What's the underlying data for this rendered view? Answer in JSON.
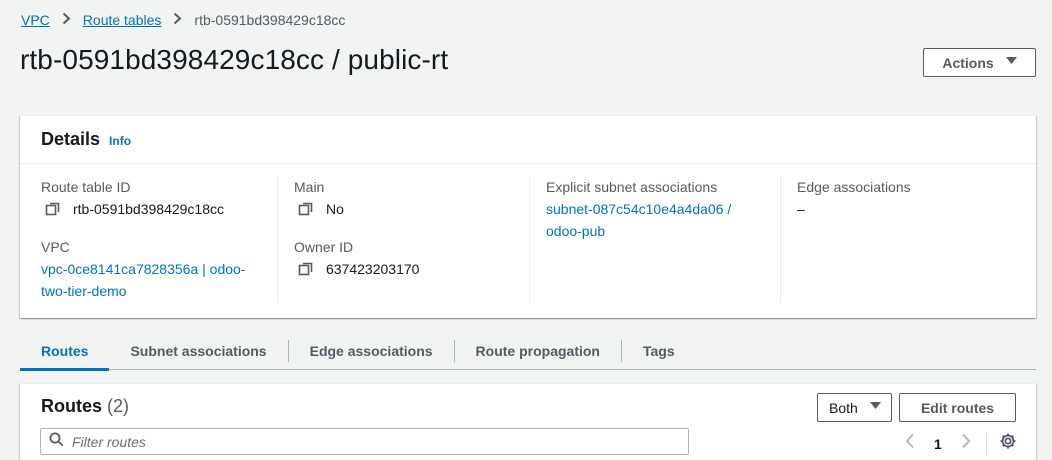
{
  "breadcrumb": {
    "items": [
      "VPC",
      "Route tables"
    ],
    "current": "rtb-0591bd398429c18cc"
  },
  "page_title": "rtb-0591bd398429c18cc / public-rt",
  "actions_label": "Actions",
  "details": {
    "title": "Details",
    "info": "Info",
    "route_table_id_label": "Route table ID",
    "route_table_id": "rtb-0591bd398429c18cc",
    "vpc_label": "VPC",
    "vpc_value": "vpc-0ce8141ca7828356a | odoo-two-tier-demo",
    "main_label": "Main",
    "main_value": "No",
    "owner_label": "Owner ID",
    "owner_value": "637423203170",
    "explicit_label": "Explicit subnet associations",
    "explicit_value": "subnet-087c54c10e4a4da06 / odoo-pub",
    "edge_label": "Edge associations",
    "edge_value": "–"
  },
  "tabs": [
    "Routes",
    "Subnet associations",
    "Edge associations",
    "Route propagation",
    "Tags"
  ],
  "routes": {
    "title": "Routes",
    "count": "(2)",
    "filter_select": "Both",
    "edit_label": "Edit routes",
    "filter_placeholder": "Filter routes",
    "page": "1"
  },
  "colors": {
    "link": "#0073bb",
    "text": "#16191f",
    "muted": "#545b64",
    "background": "#f2f3f3"
  },
  "icons": [
    "chevron-right-icon",
    "caret-down-icon",
    "copy-icon",
    "search-icon",
    "chevron-left-icon",
    "gear-icon"
  ]
}
